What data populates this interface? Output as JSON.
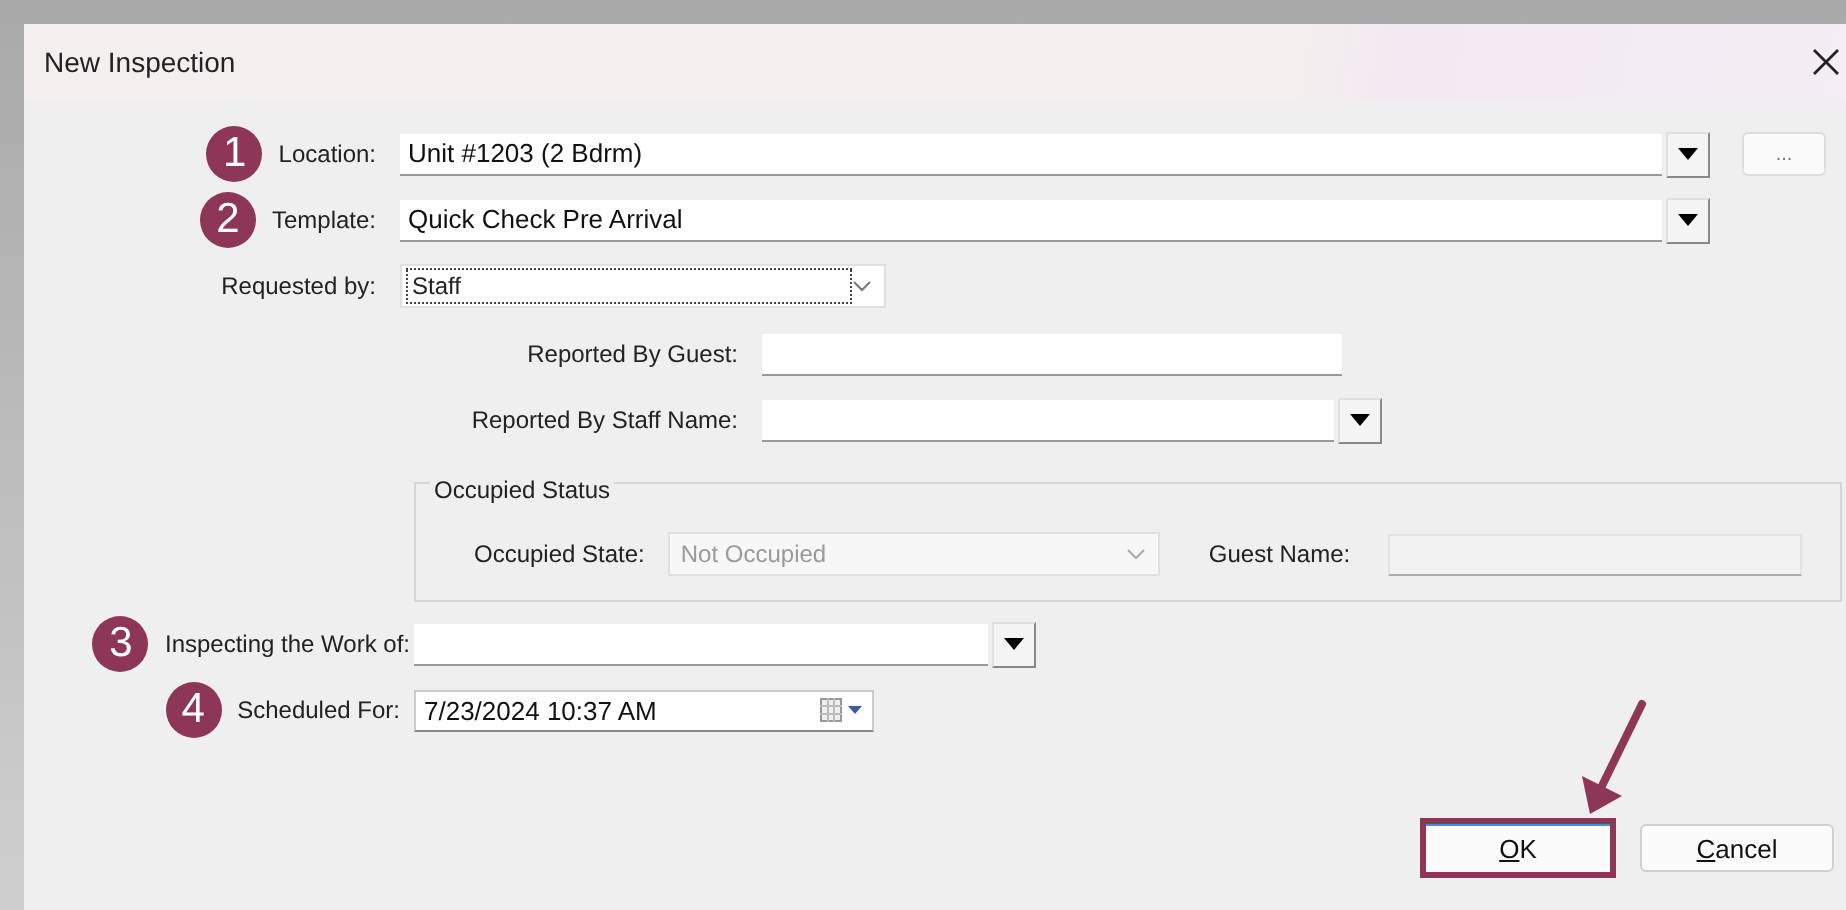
{
  "dialog": {
    "title": "New Inspection"
  },
  "fields": [
    {
      "step": "1",
      "label": "Location:",
      "kind": "dropdown",
      "value": "Unit #1203 (2 Bdrm)",
      "browse": "..."
    },
    {
      "step": "2",
      "label": "Template:",
      "kind": "dropdown",
      "value": "Quick Check Pre Arrival"
    },
    {
      "label": "Requested by:",
      "kind": "select",
      "value": "Staff",
      "focused": true
    }
  ],
  "requester_fields": [
    {
      "label": "Reported By Guest:",
      "kind": "text"
    },
    {
      "label": "Reported By Staff Name:",
      "kind": "dropdown"
    }
  ],
  "occupied_status": {
    "legend": "Occupied Status",
    "state_label": "Occupied State:",
    "state_value": "Not Occupied",
    "guest_name_label": "Guest Name:",
    "disabled": true
  },
  "schedule_fields": [
    {
      "step": "3",
      "label": "Inspecting the Work of:",
      "kind": "dropdown"
    },
    {
      "step": "4",
      "label": "Scheduled For:",
      "kind": "date",
      "value": "7/23/2024 10:37 AM"
    }
  ],
  "buttons": [
    {
      "label": "OK",
      "highlighted": true
    },
    {
      "label": "Cancel",
      "highlighted": false
    }
  ]
}
